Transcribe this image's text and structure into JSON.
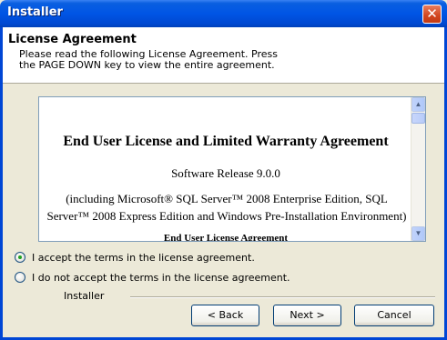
{
  "window": {
    "title": "Installer",
    "close_glyph": "✕"
  },
  "header": {
    "title": "License Agreement",
    "description": "Please read the following License Agreement.  Press the PAGE DOWN key to view the entire agreement."
  },
  "license": {
    "heading": "End User License and Limited Warranty Agreement",
    "release": "Software Release 9.0.0",
    "including": "(including Microsoft® SQL Server™ 2008 Enterprise Edition, SQL Server™ 2008 Express Edition and Windows Pre-Installation Environment)",
    "subheading": "End User License Agreement"
  },
  "scrollbar": {
    "up_glyph": "▲",
    "down_glyph": "▼"
  },
  "options": {
    "accept": "I accept the terms in the license agreement.",
    "decline": "I do not accept the terms in the license agreement.",
    "selected": "accept"
  },
  "footer": {
    "group_label": "Installer",
    "back": "< Back",
    "next": "Next >",
    "cancel": "Cancel"
  }
}
